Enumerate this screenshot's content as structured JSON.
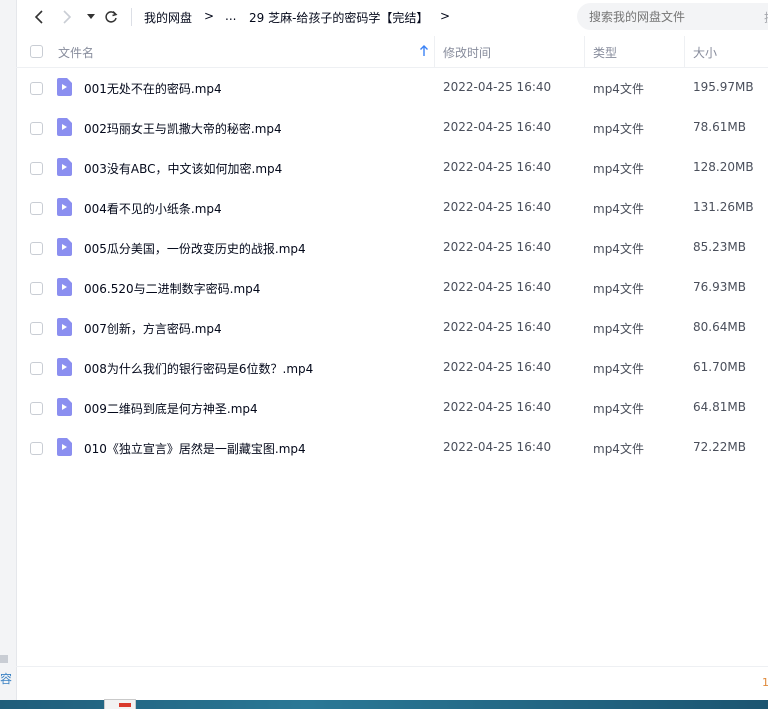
{
  "sidebar": {
    "hint_text": "容"
  },
  "breadcrumb": {
    "root": "我的网盘",
    "ellipsis": "...",
    "current": "29 芝麻-给孩子的密码学【完结】",
    "arrow": ">"
  },
  "search": {
    "placeholder": "搜索我的网盘文件",
    "extra": "搜"
  },
  "table": {
    "columns": {
      "name": "文件名",
      "modified": "修改时间",
      "type": "类型",
      "size": "大小"
    },
    "rows": [
      {
        "name": "001无处不在的密码.mp4",
        "modified": "2022-04-25 16:40",
        "type": "mp4文件",
        "size": "195.97MB"
      },
      {
        "name": "002玛丽女王与凯撒大帝的秘密.mp4",
        "modified": "2022-04-25 16:40",
        "type": "mp4文件",
        "size": "78.61MB"
      },
      {
        "name": "003没有ABC，中文该如何加密.mp4",
        "modified": "2022-04-25 16:40",
        "type": "mp4文件",
        "size": "128.20MB"
      },
      {
        "name": "004看不见的小纸条.mp4",
        "modified": "2022-04-25 16:40",
        "type": "mp4文件",
        "size": "131.26MB"
      },
      {
        "name": "005瓜分美国，一份改变历史的战报.mp4",
        "modified": "2022-04-25 16:40",
        "type": "mp4文件",
        "size": "85.23MB"
      },
      {
        "name": "006.520与二进制数字密码.mp4",
        "modified": "2022-04-25 16:40",
        "type": "mp4文件",
        "size": "76.93MB"
      },
      {
        "name": "007创新，方言密码.mp4",
        "modified": "2022-04-25 16:40",
        "type": "mp4文件",
        "size": "80.64MB"
      },
      {
        "name": "008为什么我们的银行密码是6位数？.mp4",
        "modified": "2022-04-25 16:40",
        "type": "mp4文件",
        "size": "61.70MB"
      },
      {
        "name": "009二维码到底是何方神圣.mp4",
        "modified": "2022-04-25 16:40",
        "type": "mp4文件",
        "size": "64.81MB"
      },
      {
        "name": "010《独立宣言》居然是一副藏宝图.mp4",
        "modified": "2022-04-25 16:40",
        "type": "mp4文件",
        "size": "72.22MB"
      }
    ]
  },
  "footer": {
    "count_fragment": "1"
  },
  "colors": {
    "video_icon": "#8b8ff0",
    "accent": "#3b82f6",
    "text": "#03081a",
    "muted": "#878c9c"
  }
}
